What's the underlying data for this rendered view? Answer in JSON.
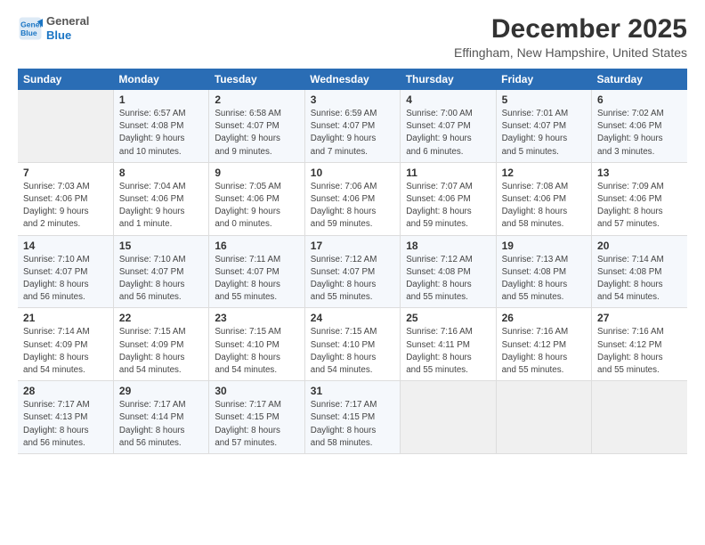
{
  "header": {
    "logo_line1": "General",
    "logo_line2": "Blue",
    "title": "December 2025",
    "location": "Effingham, New Hampshire, United States"
  },
  "columns": [
    "Sunday",
    "Monday",
    "Tuesday",
    "Wednesday",
    "Thursday",
    "Friday",
    "Saturday"
  ],
  "weeks": [
    [
      {
        "day": "",
        "info": ""
      },
      {
        "day": "1",
        "info": "Sunrise: 6:57 AM\nSunset: 4:08 PM\nDaylight: 9 hours\nand 10 minutes."
      },
      {
        "day": "2",
        "info": "Sunrise: 6:58 AM\nSunset: 4:07 PM\nDaylight: 9 hours\nand 9 minutes."
      },
      {
        "day": "3",
        "info": "Sunrise: 6:59 AM\nSunset: 4:07 PM\nDaylight: 9 hours\nand 7 minutes."
      },
      {
        "day": "4",
        "info": "Sunrise: 7:00 AM\nSunset: 4:07 PM\nDaylight: 9 hours\nand 6 minutes."
      },
      {
        "day": "5",
        "info": "Sunrise: 7:01 AM\nSunset: 4:07 PM\nDaylight: 9 hours\nand 5 minutes."
      },
      {
        "day": "6",
        "info": "Sunrise: 7:02 AM\nSunset: 4:06 PM\nDaylight: 9 hours\nand 3 minutes."
      }
    ],
    [
      {
        "day": "7",
        "info": "Sunrise: 7:03 AM\nSunset: 4:06 PM\nDaylight: 9 hours\nand 2 minutes."
      },
      {
        "day": "8",
        "info": "Sunrise: 7:04 AM\nSunset: 4:06 PM\nDaylight: 9 hours\nand 1 minute."
      },
      {
        "day": "9",
        "info": "Sunrise: 7:05 AM\nSunset: 4:06 PM\nDaylight: 9 hours\nand 0 minutes."
      },
      {
        "day": "10",
        "info": "Sunrise: 7:06 AM\nSunset: 4:06 PM\nDaylight: 8 hours\nand 59 minutes."
      },
      {
        "day": "11",
        "info": "Sunrise: 7:07 AM\nSunset: 4:06 PM\nDaylight: 8 hours\nand 59 minutes."
      },
      {
        "day": "12",
        "info": "Sunrise: 7:08 AM\nSunset: 4:06 PM\nDaylight: 8 hours\nand 58 minutes."
      },
      {
        "day": "13",
        "info": "Sunrise: 7:09 AM\nSunset: 4:06 PM\nDaylight: 8 hours\nand 57 minutes."
      }
    ],
    [
      {
        "day": "14",
        "info": "Sunrise: 7:10 AM\nSunset: 4:07 PM\nDaylight: 8 hours\nand 56 minutes."
      },
      {
        "day": "15",
        "info": "Sunrise: 7:10 AM\nSunset: 4:07 PM\nDaylight: 8 hours\nand 56 minutes."
      },
      {
        "day": "16",
        "info": "Sunrise: 7:11 AM\nSunset: 4:07 PM\nDaylight: 8 hours\nand 55 minutes."
      },
      {
        "day": "17",
        "info": "Sunrise: 7:12 AM\nSunset: 4:07 PM\nDaylight: 8 hours\nand 55 minutes."
      },
      {
        "day": "18",
        "info": "Sunrise: 7:12 AM\nSunset: 4:08 PM\nDaylight: 8 hours\nand 55 minutes."
      },
      {
        "day": "19",
        "info": "Sunrise: 7:13 AM\nSunset: 4:08 PM\nDaylight: 8 hours\nand 55 minutes."
      },
      {
        "day": "20",
        "info": "Sunrise: 7:14 AM\nSunset: 4:08 PM\nDaylight: 8 hours\nand 54 minutes."
      }
    ],
    [
      {
        "day": "21",
        "info": "Sunrise: 7:14 AM\nSunset: 4:09 PM\nDaylight: 8 hours\nand 54 minutes."
      },
      {
        "day": "22",
        "info": "Sunrise: 7:15 AM\nSunset: 4:09 PM\nDaylight: 8 hours\nand 54 minutes."
      },
      {
        "day": "23",
        "info": "Sunrise: 7:15 AM\nSunset: 4:10 PM\nDaylight: 8 hours\nand 54 minutes."
      },
      {
        "day": "24",
        "info": "Sunrise: 7:15 AM\nSunset: 4:10 PM\nDaylight: 8 hours\nand 54 minutes."
      },
      {
        "day": "25",
        "info": "Sunrise: 7:16 AM\nSunset: 4:11 PM\nDaylight: 8 hours\nand 55 minutes."
      },
      {
        "day": "26",
        "info": "Sunrise: 7:16 AM\nSunset: 4:12 PM\nDaylight: 8 hours\nand 55 minutes."
      },
      {
        "day": "27",
        "info": "Sunrise: 7:16 AM\nSunset: 4:12 PM\nDaylight: 8 hours\nand 55 minutes."
      }
    ],
    [
      {
        "day": "28",
        "info": "Sunrise: 7:17 AM\nSunset: 4:13 PM\nDaylight: 8 hours\nand 56 minutes."
      },
      {
        "day": "29",
        "info": "Sunrise: 7:17 AM\nSunset: 4:14 PM\nDaylight: 8 hours\nand 56 minutes."
      },
      {
        "day": "30",
        "info": "Sunrise: 7:17 AM\nSunset: 4:15 PM\nDaylight: 8 hours\nand 57 minutes."
      },
      {
        "day": "31",
        "info": "Sunrise: 7:17 AM\nSunset: 4:15 PM\nDaylight: 8 hours\nand 58 minutes."
      },
      {
        "day": "",
        "info": ""
      },
      {
        "day": "",
        "info": ""
      },
      {
        "day": "",
        "info": ""
      }
    ]
  ]
}
